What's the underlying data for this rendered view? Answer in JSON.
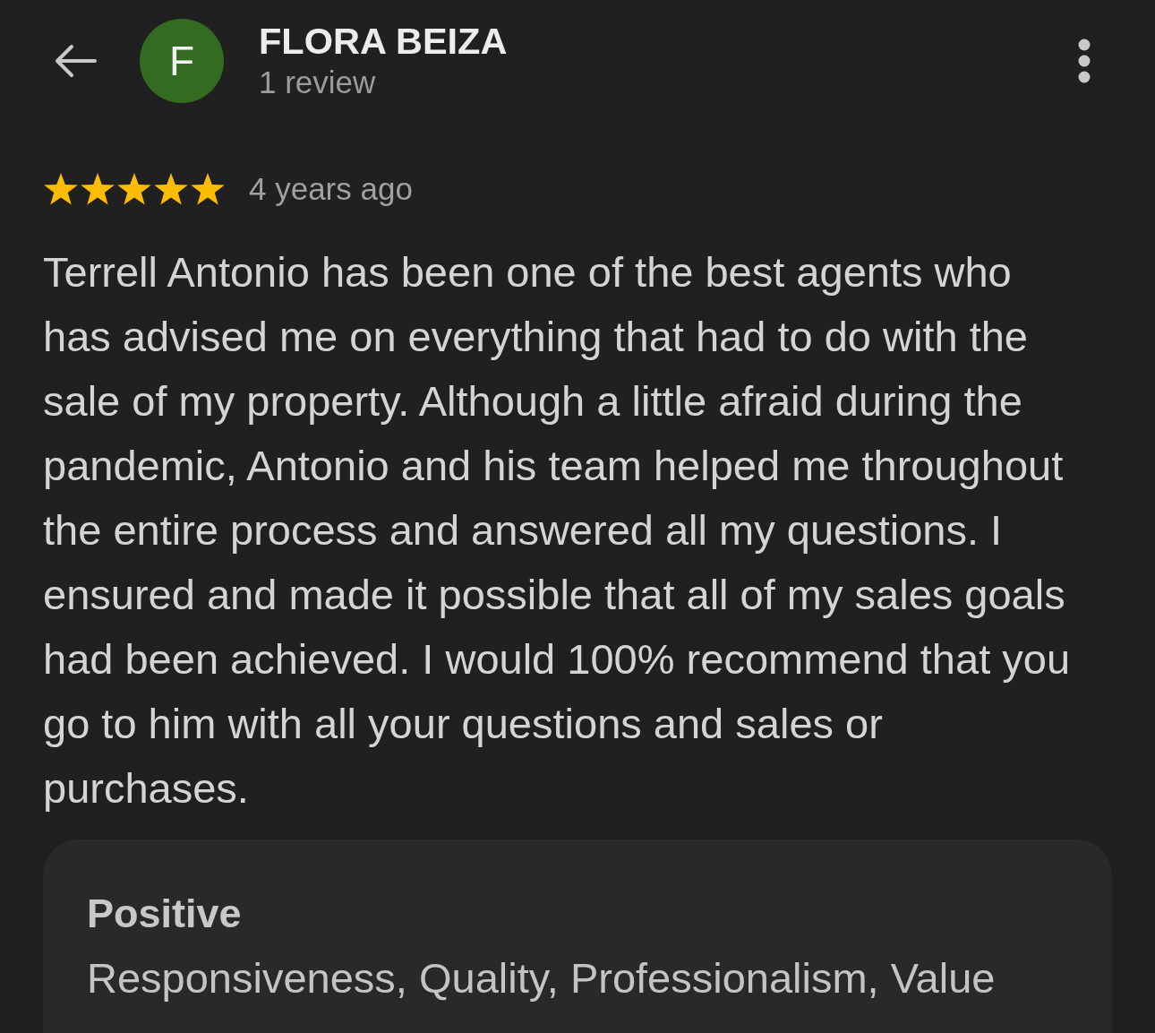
{
  "reviewer": {
    "initial": "F",
    "name": "FLORA BEIZA",
    "review_count": "1 review"
  },
  "review": {
    "stars": 5,
    "time": "4 years ago",
    "text": "Terrell Antonio has been one of the best agents who has advised me on everything that had to do with the sale of my property. Although a little afraid during the pandemic, Antonio and his team helped me throughout the entire process and answered all my questions. I ensured and made it possible that all of my sales goals had been achieved. I would 100% recommend that you go to him with all your questions and sales or purchases."
  },
  "highlights": [
    {
      "title": "Positive",
      "attributes": "Responsiveness, Quality, Professionalism, Value"
    }
  ]
}
